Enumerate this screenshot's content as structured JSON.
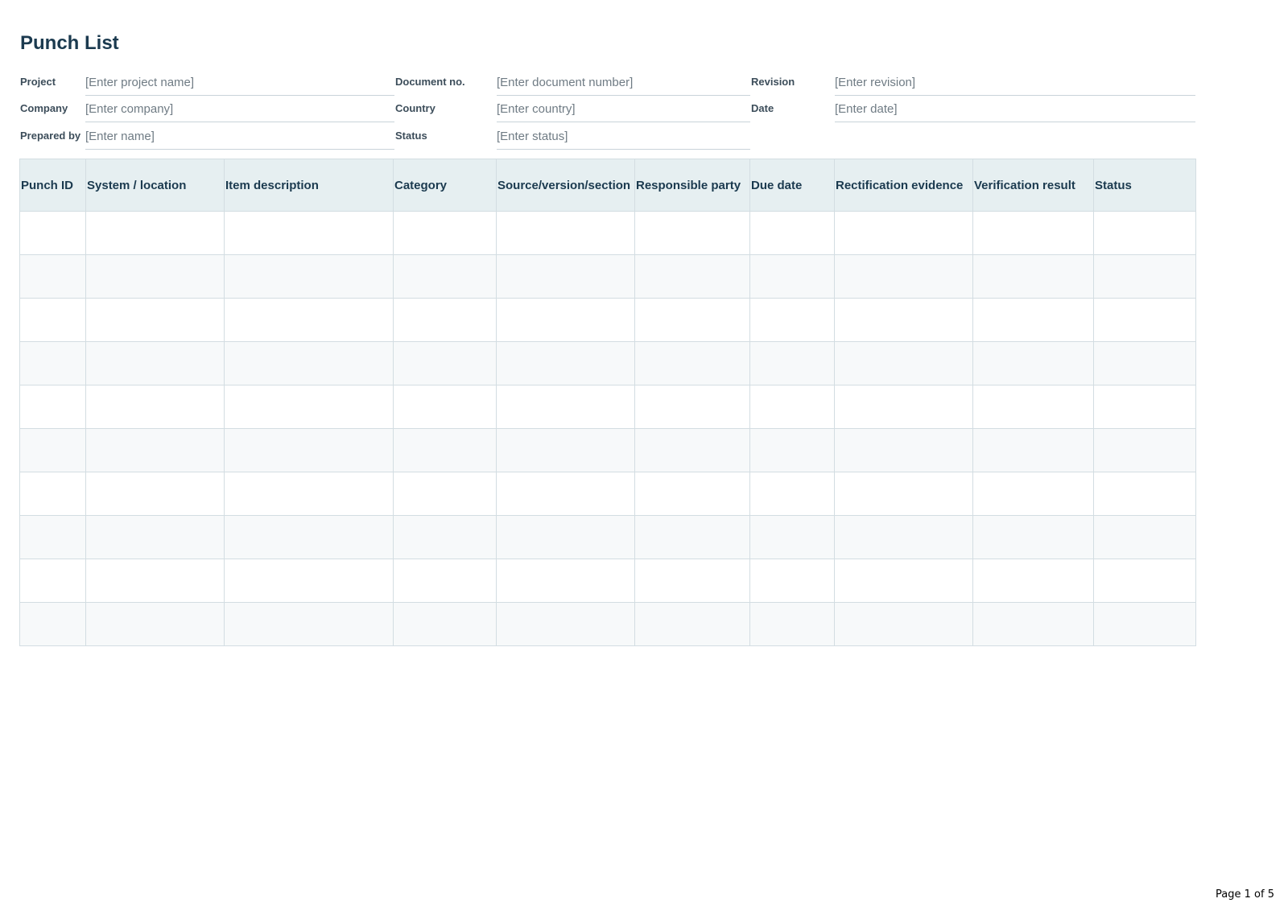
{
  "title": "Punch List",
  "meta": {
    "project": {
      "label": "Project",
      "placeholder": "[Enter project name]"
    },
    "document_no": {
      "label": "Document no.",
      "placeholder": "[Enter document number]"
    },
    "revision": {
      "label": "Revision",
      "placeholder": "[Enter revision]"
    },
    "company": {
      "label": "Company",
      "placeholder": "[Enter company]"
    },
    "country": {
      "label": "Country",
      "placeholder": "[Enter country]"
    },
    "date": {
      "label": "Date",
      "placeholder": "[Enter date]"
    },
    "prepared_by": {
      "label": "Prepared by",
      "placeholder": "[Enter name]"
    },
    "status": {
      "label": "Status",
      "placeholder": "[Enter status]"
    }
  },
  "table": {
    "columns": [
      "Punch ID",
      "System / location",
      "Item description",
      "Category",
      "Source/version/section",
      "Responsible party",
      "Due date",
      "Rectification evidence",
      "Verification result",
      "Status"
    ],
    "rows": [
      [
        "",
        "",
        "",
        "",
        "",
        "",
        "",
        "",
        "",
        ""
      ],
      [
        "",
        "",
        "",
        "",
        "",
        "",
        "",
        "",
        "",
        ""
      ],
      [
        "",
        "",
        "",
        "",
        "",
        "",
        "",
        "",
        "",
        ""
      ],
      [
        "",
        "",
        "",
        "",
        "",
        "",
        "",
        "",
        "",
        ""
      ],
      [
        "",
        "",
        "",
        "",
        "",
        "",
        "",
        "",
        "",
        ""
      ],
      [
        "",
        "",
        "",
        "",
        "",
        "",
        "",
        "",
        "",
        ""
      ],
      [
        "",
        "",
        "",
        "",
        "",
        "",
        "",
        "",
        "",
        ""
      ],
      [
        "",
        "",
        "",
        "",
        "",
        "",
        "",
        "",
        "",
        ""
      ],
      [
        "",
        "",
        "",
        "",
        "",
        "",
        "",
        "",
        "",
        ""
      ],
      [
        "",
        "",
        "",
        "",
        "",
        "",
        "",
        "",
        "",
        ""
      ]
    ]
  },
  "footer": {
    "page": "Page 1 of 5"
  },
  "colors": {
    "header_bg": "#e6eff1",
    "title": "#1b3a4f",
    "grid": "#d3dde2",
    "zebra": "#f7f9fa"
  }
}
